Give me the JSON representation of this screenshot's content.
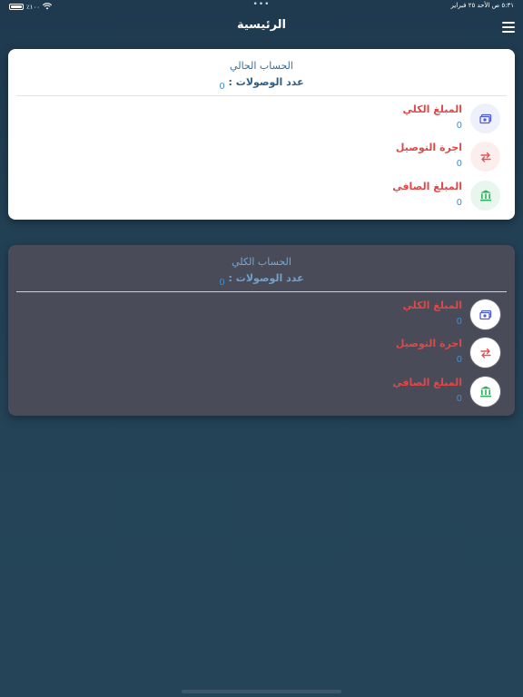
{
  "status_bar": {
    "time_date": "٥:٣١ ص   الأحد ٢٥ فبراير",
    "battery": "٪١٠٠",
    "dots": "•••"
  },
  "nav": {
    "title": "الرئيسية",
    "menu_icon": "hamburger-menu-icon"
  },
  "current_account": {
    "title": "الحساب الحالي",
    "receipts_label": "عدد الوصولات :",
    "receipts_value": "0",
    "rows": [
      {
        "label": "المبلغ الكلي",
        "value": "0",
        "icon": "money-icon",
        "icon_color": "#4f5bd5"
      },
      {
        "label": "اجرة التوصيل",
        "value": "0",
        "icon": "swap-arrows-icon",
        "icon_color": "#e25555"
      },
      {
        "label": "المبلغ الصافي",
        "value": "0",
        "icon": "bank-icon",
        "icon_color": "#2fae5b"
      }
    ]
  },
  "total_account": {
    "title": "الحساب الكلي",
    "receipts_label": "عدد الوصولات :",
    "receipts_value": "0",
    "rows": [
      {
        "label": "المبلغ الكلي",
        "value": "0",
        "icon": "money-icon",
        "icon_color": "#4f5bd5"
      },
      {
        "label": "اجرة التوصيل",
        "value": "0",
        "icon": "swap-arrows-icon",
        "icon_color": "#e25555"
      },
      {
        "label": "المبلغ الصافي",
        "value": "0",
        "icon": "bank-icon",
        "icon_color": "#2fae5b"
      }
    ]
  }
}
